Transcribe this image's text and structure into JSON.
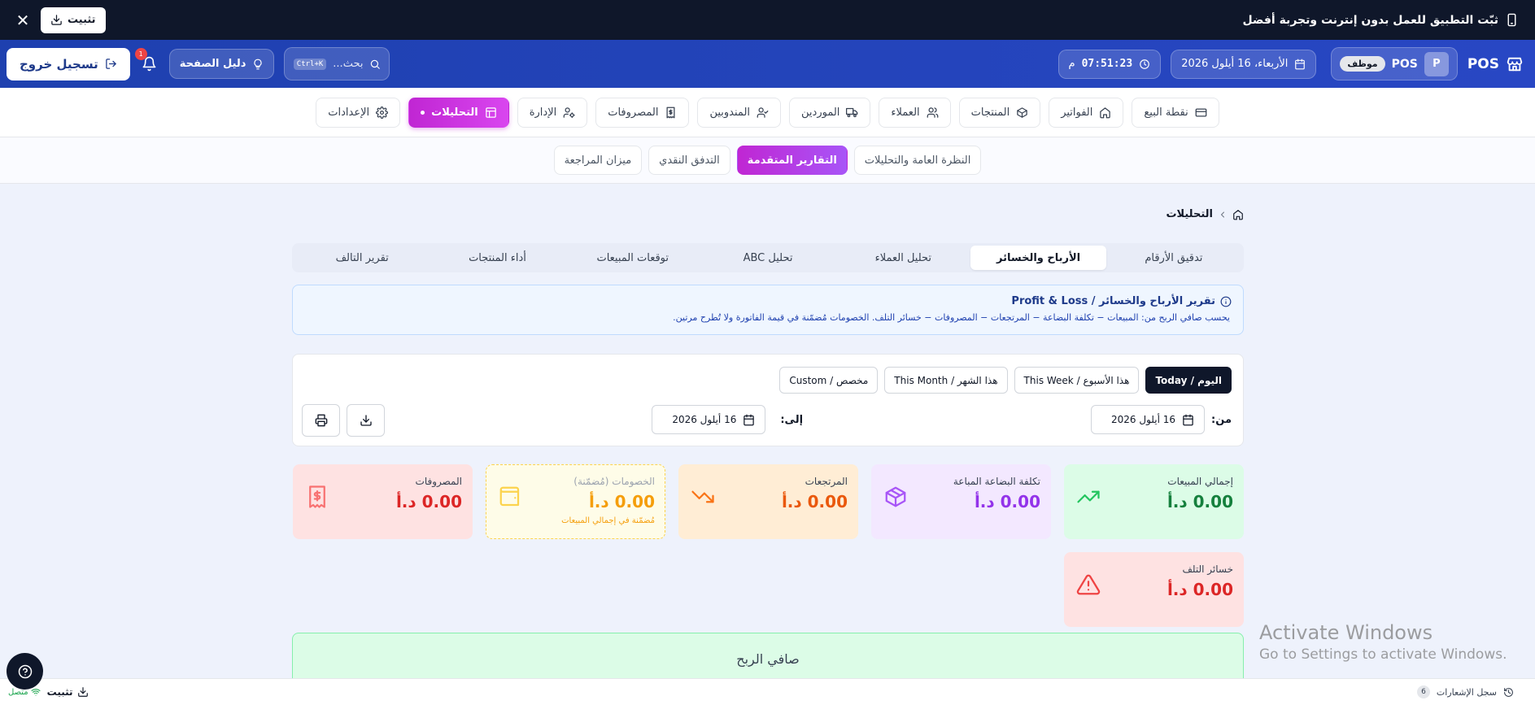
{
  "banner": {
    "text": "ثبّت التطبيق للعمل بدون إنترنت وتجربة أفضل",
    "install_label": "تثبيت",
    "close_label": "✕"
  },
  "header": {
    "brand": "POS",
    "user_initial": "P",
    "user_name": "POS",
    "role": "موظف",
    "date": "الأربعاء، 16 أيلول 2026",
    "time": "07:51:23",
    "time_suffix": "م",
    "search_placeholder": "بحث...",
    "search_shortcut": "Ctrl+K",
    "guide_label": "دليل الصفحة",
    "notification_count": "1",
    "logout_label": "تسجيل خروج"
  },
  "main_nav": [
    {
      "label": "نقطة البيع",
      "icon": "credit-card-icon"
    },
    {
      "label": "الفواتير",
      "icon": "home-icon"
    },
    {
      "label": "المنتجات",
      "icon": "box-icon"
    },
    {
      "label": "العملاء",
      "icon": "users-icon"
    },
    {
      "label": "الموردين",
      "icon": "truck-icon"
    },
    {
      "label": "المندوبين",
      "icon": "user-check-icon"
    },
    {
      "label": "المصروفات",
      "icon": "receipt-icon"
    },
    {
      "label": "الإدارة",
      "icon": "user-cog-icon"
    },
    {
      "label": "التحليلات",
      "icon": "layout-icon",
      "active": true
    },
    {
      "label": "الإعدادات",
      "icon": "gear-icon"
    }
  ],
  "sub_nav": [
    {
      "label": "النظرة العامة والتحليلات"
    },
    {
      "label": "التقارير المتقدمة",
      "active": true
    },
    {
      "label": "التدفق النقدي"
    },
    {
      "label": "ميزان المراجعة"
    }
  ],
  "breadcrumb": {
    "current": "التحليلات"
  },
  "report_tabs": [
    {
      "label": "تدقيق الأرقام"
    },
    {
      "label": "الأرباح والخسائر",
      "active": true
    },
    {
      "label": "تحليل العملاء"
    },
    {
      "label": "تحليل ABC"
    },
    {
      "label": "توقعات المبيعات"
    },
    {
      "label": "أداء المنتجات"
    },
    {
      "label": "تقرير التالف"
    }
  ],
  "info": {
    "title": "تقرير الأرباح والخسائر / Profit & Loss",
    "description": "يحسب صافي الربح من: المبيعات − تكلفة البضاعة − المرتجعات − المصروفات − خسائر التلف. الخصومات مُضمّنة في قيمة الفاتورة ولا تُطرح مرتين."
  },
  "filters": {
    "presets": [
      {
        "label": "اليوم / Today",
        "active": true
      },
      {
        "label": "هذا الأسبوع / This Week"
      },
      {
        "label": "هذا الشهر / This Month"
      },
      {
        "label": "مخصص / Custom"
      }
    ],
    "from_label": "من:",
    "from_date": "16 أيلول 2026",
    "to_label": "إلى:",
    "to_date": "16 أيلول 2026"
  },
  "cards": [
    {
      "label": "إجمالي المبيعات",
      "value": "0.00 د.أ",
      "color": "#16a34a",
      "bg": "#dcfce7",
      "icon": "trending-up-icon"
    },
    {
      "label": "تكلفة البضاعة المباعة",
      "value": "0.00 د.أ",
      "color": "#9333ea",
      "bg": "#f3e8ff",
      "icon": "package-icon"
    },
    {
      "label": "المرتجعات",
      "value": "0.00 د.أ",
      "color": "#ea580c",
      "bg": "#ffedd5",
      "icon": "trending-down-icon"
    },
    {
      "label": "الخصومات (مُضمّنة)",
      "value": "0.00 د.أ",
      "note": "مُضمّنة في إجمالي المبيعات",
      "color": "#f59e0b",
      "bg": "#fefce8",
      "icon": "wallet-icon"
    },
    {
      "label": "المصروفات",
      "value": "0.00 د.أ",
      "color": "#dc2626",
      "bg": "#fee2e2",
      "icon": "receipt-icon"
    },
    {
      "label": "خسائر التلف",
      "value": "0.00 د.أ",
      "color": "#dc2626",
      "bg": "#fee2e2",
      "icon": "alert-triangle-icon"
    }
  ],
  "net_profit": {
    "title": "صافي الربح"
  },
  "watermark": {
    "title": "Activate Windows",
    "subtitle": "Go to Settings to activate Windows."
  },
  "statusbar": {
    "log_label": "سجل الإشعارات",
    "log_count": "6",
    "install_label": "تثبيت",
    "online_label": "متصل"
  }
}
